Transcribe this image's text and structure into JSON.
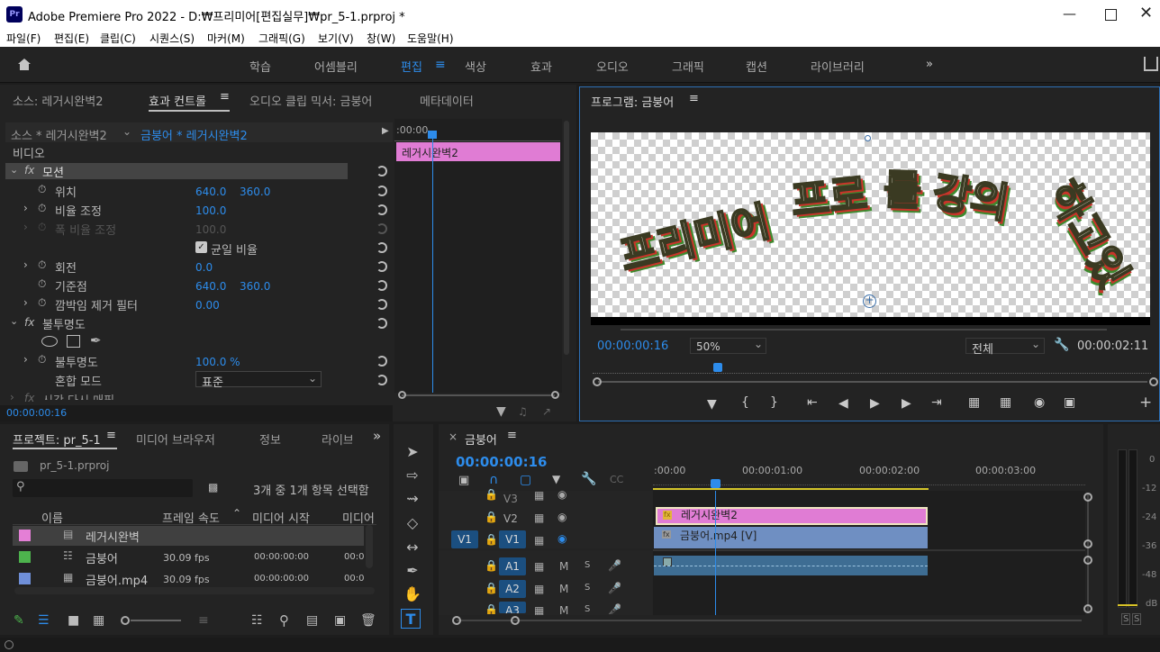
{
  "window": {
    "title": "Adobe Premiere Pro 2022 - D:₩프리미어[편집실무]₩pr_5-1.prproj *",
    "logo": "Pr"
  },
  "menu": [
    "파일(F)",
    "편집(E)",
    "클립(C)",
    "시퀀스(S)",
    "마커(M)",
    "그래픽(G)",
    "보기(V)",
    "창(W)",
    "도움말(H)"
  ],
  "workspaces": [
    "학습",
    "어셈블리",
    "편집",
    "색상",
    "효과",
    "오디오",
    "그래픽",
    "캡션",
    "라이브러리"
  ],
  "source_panel": {
    "tabs": [
      "소스: 레거시완벽2",
      "효과 컨트롤",
      "오디오 클립 믹서: 금붕어",
      "메타데이터"
    ],
    "source_label": "소스 * 레거시완벽2",
    "sequence_label": "금붕어 * 레거시완벽2",
    "time_start": ":00:00",
    "clip_name": "레거시완벽2",
    "video_header": "비디오",
    "motion": "모션",
    "position_label": "위치",
    "position_x": "640.0",
    "position_y": "360.0",
    "scale_label": "비율 조정",
    "scale_value": "100.0",
    "scale_width_label": "폭 비율 조정",
    "scale_width_value": "100.0",
    "uniform_label": "균일 비율",
    "rotation_label": "회전",
    "rotation_value": "0.0",
    "anchor_label": "기준점",
    "anchor_x": "640.0",
    "anchor_y": "360.0",
    "flicker_label": "깜박임 제거 필터",
    "flicker_value": "0.00",
    "opacity_header": "불투명도",
    "opacity_label": "불투명도",
    "opacity_value": "100.0 %",
    "blend_label": "혼합 모드",
    "blend_value": "표준",
    "remap_label": "시간 다시 매핑",
    "timecode": "00:00:00:16"
  },
  "program_monitor": {
    "title": "프로그램: 금붕어",
    "overlay_text": [
      "프리미어",
      "프로",
      "를",
      "강의",
      "하고있"
    ],
    "timecode": "00:00:00:16",
    "zoom": "50%",
    "quality": "전체",
    "duration": "00:00:02:11"
  },
  "project_panel": {
    "tabs": [
      "프로젝트: pr_5-1",
      "미디어 브라우저",
      "정보",
      "라이브"
    ],
    "file": "pr_5-1.prproj",
    "selection": "3개 중 1개 항목 선택함",
    "columns": [
      "이름",
      "프레임 속도",
      "미디어 시작",
      "미디어"
    ],
    "items": [
      {
        "name": "레거시완벽",
        "fps": "",
        "start": "",
        "extra": "",
        "color": "#e47fd6"
      },
      {
        "name": "금붕어",
        "fps": "30.09 fps",
        "start": "00:00:00:00",
        "extra": "00:0",
        "color": "#4db34d"
      },
      {
        "name": "금붕어.mp4",
        "fps": "30.09 fps",
        "start": "00:00:00:00",
        "extra": "00:0",
        "color": "#6f8fd8"
      }
    ]
  },
  "timeline": {
    "tab": "금붕어",
    "timecode": "00:00:00:16",
    "ruler": [
      ":00:00",
      "00:00:01:00",
      "00:00:02:00",
      "00:00:03:00"
    ],
    "video_tracks": [
      "V3",
      "V2",
      "V1"
    ],
    "audio_tracks": [
      "A1",
      "A2",
      "A3"
    ],
    "source_patch_v": "V1",
    "clip_v2": "레거시완벽2",
    "clip_v1": "금붕어.mp4 [V]",
    "m": "M",
    "s": "S"
  },
  "meter": {
    "scale": [
      "0",
      "-12",
      "-24",
      "-36",
      "-48",
      "dB"
    ],
    "solo": [
      "S",
      "S"
    ]
  }
}
